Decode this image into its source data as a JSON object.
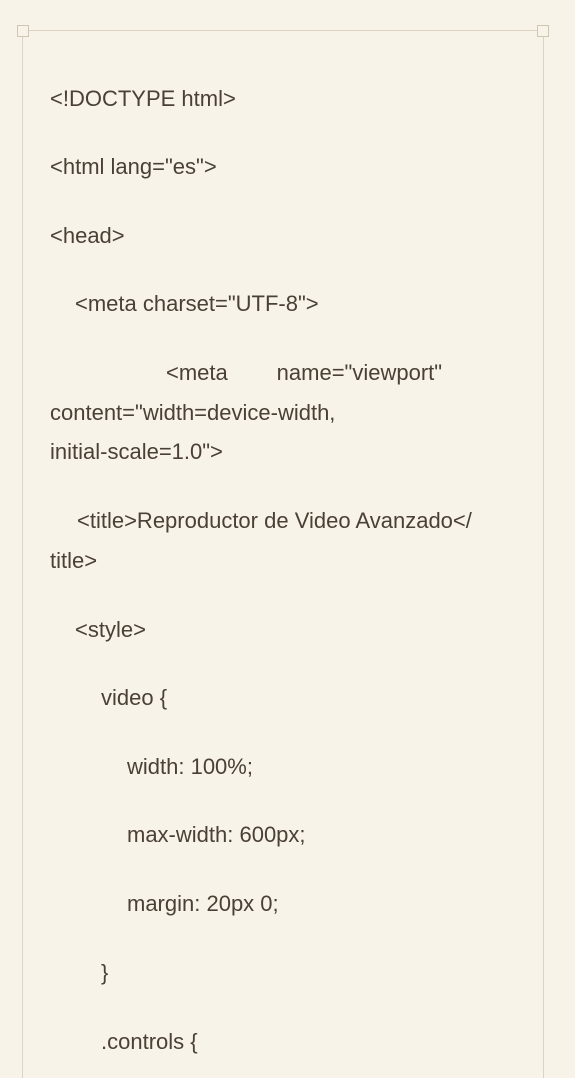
{
  "code_lines": [
    {
      "text": "<!DOCTYPE html>",
      "indent": 0
    },
    {
      "text": "<html lang=\"es\">",
      "indent": 0
    },
    {
      "text": "<head>",
      "indent": 0
    },
    {
      "text": "<meta charset=\"UTF-8\">",
      "indent": 1
    },
    {
      "text": "<meta        name=\"viewport\"",
      "indent": 0,
      "wrapped_first": true
    },
    {
      "text": "content=\"width=device-width,",
      "indent": 0
    },
    {
      "text": "initial-scale=1.0\">",
      "indent": 0
    },
    {
      "text": "<title>Reproductor de Video Avanzado</",
      "indent": 1
    },
    {
      "text": "title>",
      "indent": 0
    },
    {
      "text": "<style>",
      "indent": 1
    },
    {
      "text": "video {",
      "indent": 2
    },
    {
      "text": "width: 100%;",
      "indent": 3
    },
    {
      "text": "max-width: 600px;",
      "indent": 3
    },
    {
      "text": "margin: 20px 0;",
      "indent": 3
    },
    {
      "text": "}",
      "indent": 2
    },
    {
      "text": ".controls {",
      "indent": 2
    }
  ]
}
